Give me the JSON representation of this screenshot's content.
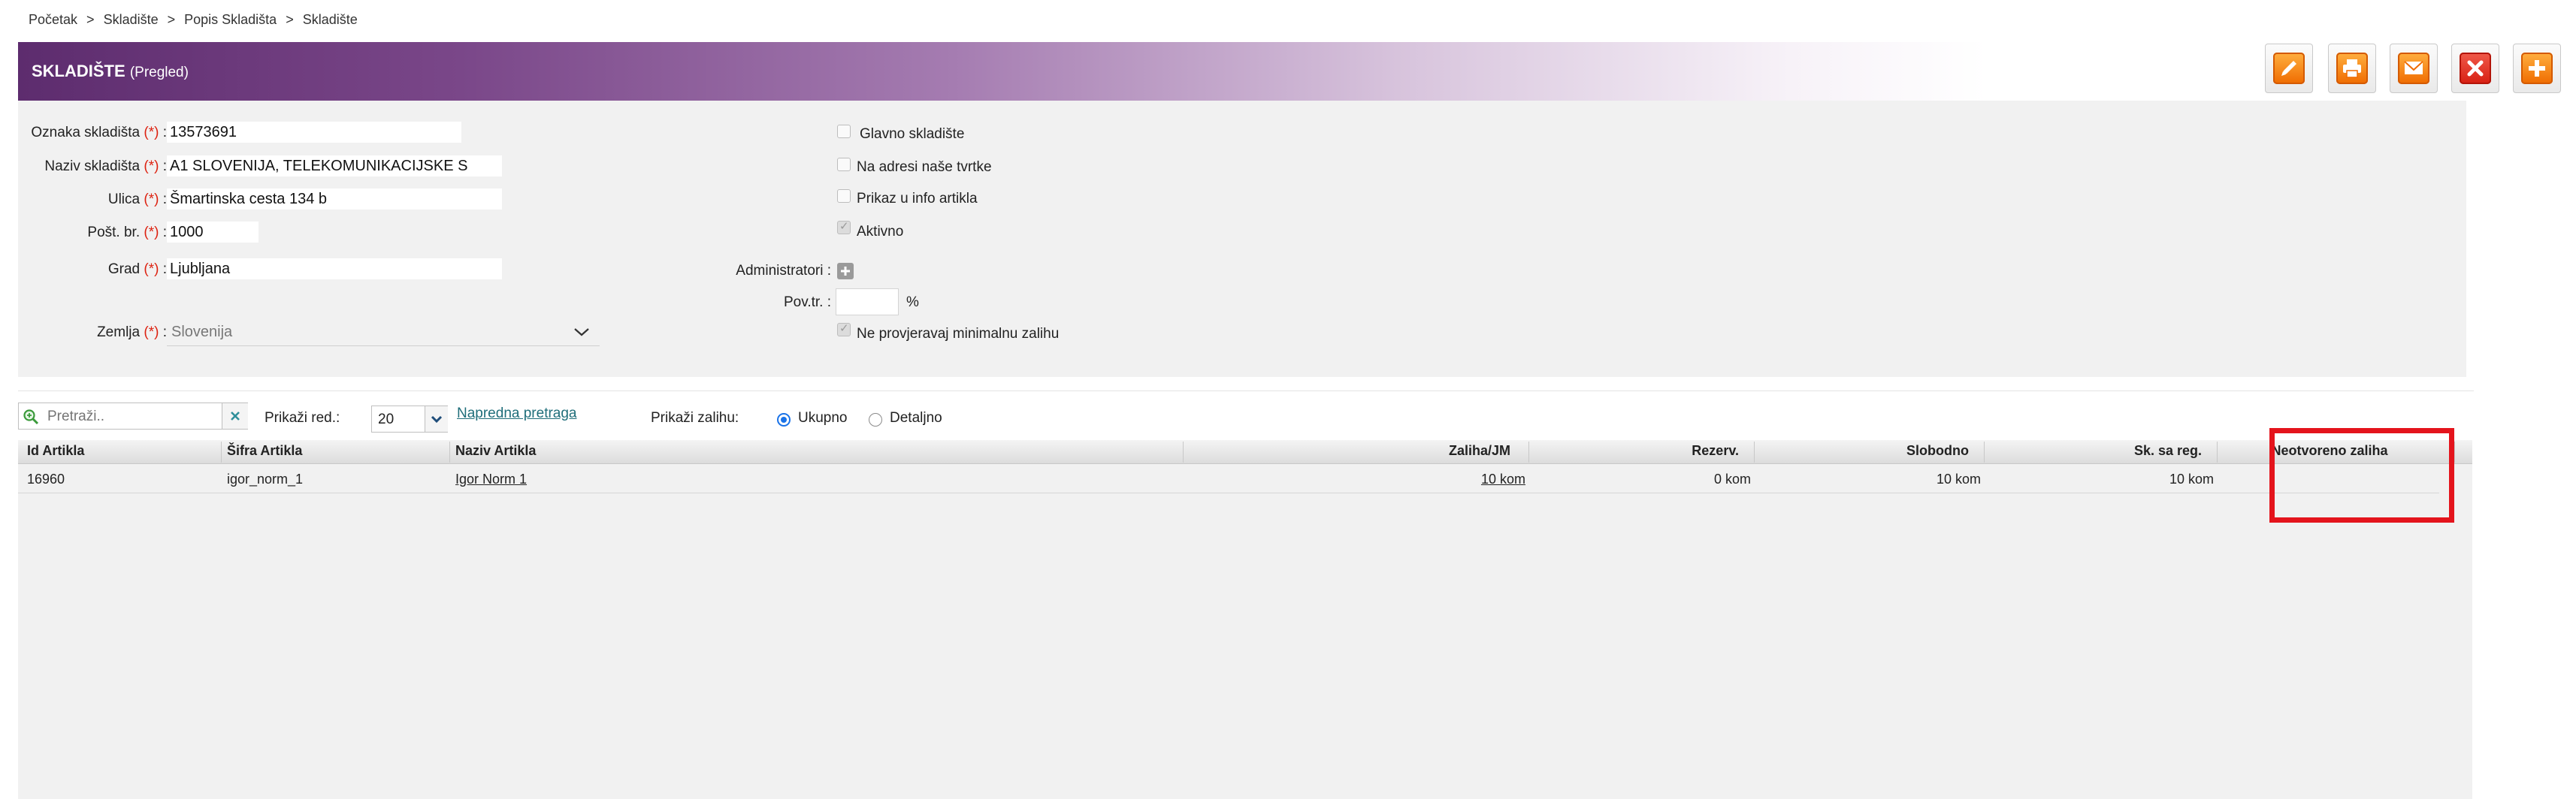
{
  "breadcrumb": [
    "Početak",
    "Skladište",
    "Popis Skladišta",
    "Skladište"
  ],
  "breadcrumb_sep": ">",
  "header": {
    "title": "SKLADIŠTE",
    "subtitle": "(Pregled)"
  },
  "toolbar": [
    "edit-icon",
    "print-icon",
    "mail-icon",
    "delete-icon",
    "add-icon"
  ],
  "form": {
    "oznaka_label": "Oznaka skladišta",
    "oznaka_value": "13573691",
    "naziv_label": "Naziv skladišta",
    "naziv_value": "A1 SLOVENIJA, TELEKOMUNIKACIJSKE S",
    "ulica_label": "Ulica",
    "ulica_value": "Šmartinska cesta 134 b",
    "post_label": "Pošt. br.",
    "post_value": "1000",
    "grad_label": "Grad",
    "grad_value": "Ljubljana",
    "zemlja_label": "Zemlja",
    "zemlja_value": "Slovenija",
    "req": "(*)",
    "colon": ":",
    "glavno_label": "Glavno skladište",
    "adresa_label": "Na adresi naše tvrtke",
    "prikaz_label": "Prikaz u info artikla",
    "aktivno_label": "Aktivno",
    "admin_label": "Administratori :",
    "povtr_label": "Pov.tr. :",
    "percent": "%",
    "minimal_label": "Ne provjeravaj minimalnu zalihu"
  },
  "filter": {
    "search_placeholder": "Pretraži..",
    "rows_label": "Prikaži red.:",
    "rows_value": "20",
    "advanced_link": "Napredna pretraga",
    "stock_label": "Prikaži zalihu:",
    "opt_total": "Ukupno",
    "opt_detail": "Detaljno"
  },
  "table": {
    "columns": [
      "Id Artikla",
      "Šifra Artikla",
      "Naziv Artikla",
      "Zaliha/JM",
      "Rezerv.",
      "Slobodno",
      "Sk. sa reg.",
      "Neotvoreno zaliha"
    ],
    "rows": [
      {
        "id": "16960",
        "sifra": "igor_norm_1",
        "naziv": "Igor Norm 1",
        "zaliha": "10 kom",
        "rezerv": "0 kom",
        "slobodno": "10 kom",
        "skreg": "10 kom",
        "neotvoreno": ""
      }
    ]
  },
  "colors": {
    "accent": "#5d2c6e",
    "highlight": "#e4141c",
    "toolbar_orange": "#ef6b00"
  }
}
